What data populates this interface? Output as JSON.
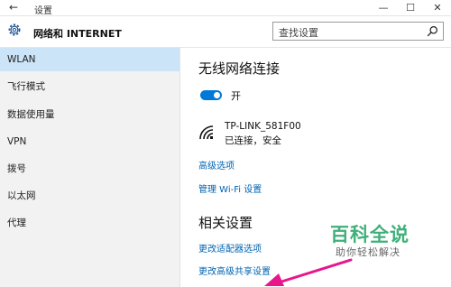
{
  "titlebar": {
    "back_glyph": "←",
    "title": "设置",
    "minimize_glyph": "—",
    "maximize_glyph": "☐",
    "close_glyph": "✕"
  },
  "header": {
    "icon": "gear-icon",
    "title": "网络和 INTERNET",
    "search_placeholder": "查找设置",
    "search_icon": "search-icon"
  },
  "sidebar": {
    "items": [
      {
        "label": "WLAN",
        "active": true
      },
      {
        "label": "飞行模式"
      },
      {
        "label": "数据使用量"
      },
      {
        "label": "VPN"
      },
      {
        "label": "拨号"
      },
      {
        "label": "以太网"
      },
      {
        "label": "代理"
      }
    ]
  },
  "main": {
    "wireless_title": "无线网络连接",
    "toggle_state": "开",
    "network": {
      "name": "TP-LINK_581F00",
      "status": "已连接，安全",
      "icon": "wifi-icon"
    },
    "advanced_link": "高级选项",
    "manage_wifi_link": "管理 Wi-Fi 设置",
    "related_title": "相关设置",
    "related_links": [
      "更改适配器选项",
      "更改高级共享设置"
    ]
  },
  "watermark": {
    "title": "百科全说",
    "subtitle": "助你轻松解决"
  },
  "colors": {
    "accent": "#0078d7",
    "link": "#0063b1",
    "sidebar_bg": "#f2f2f2",
    "selected_bg": "#cce4f7",
    "watermark_green": "#3fb07a",
    "arrow": "#e8168c"
  }
}
